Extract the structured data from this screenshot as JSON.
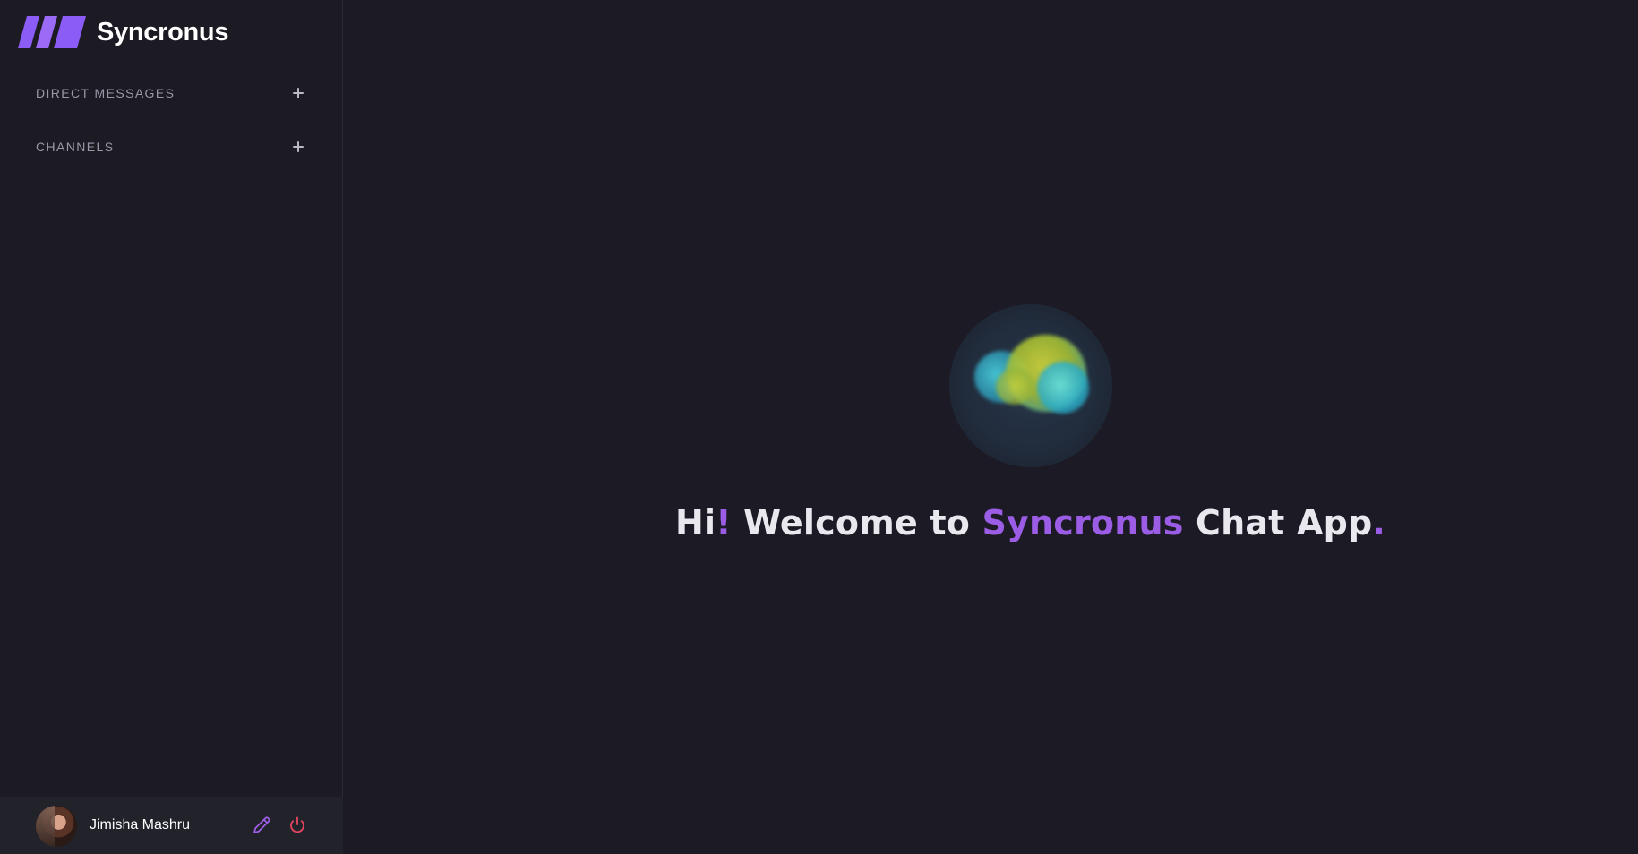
{
  "app": {
    "name": "Syncronus",
    "accent_color": "#9b5de5",
    "logo_icon": "three-slash-logo"
  },
  "sidebar": {
    "sections": [
      {
        "label": "DIRECT MESSAGES",
        "action_icon": "plus-icon"
      },
      {
        "label": "CHANNELS",
        "action_icon": "plus-icon"
      }
    ]
  },
  "profile": {
    "name": "Jimisha Mashru",
    "edit_icon": "pencil-icon",
    "logout_icon": "power-icon",
    "edit_color": "#9b5de5",
    "logout_color": "#e0455d"
  },
  "welcome": {
    "hi": "Hi",
    "exclaim": "!",
    "middle": " Welcome to ",
    "brand": "Syncronus",
    "after": " Chat App",
    "period": "."
  }
}
